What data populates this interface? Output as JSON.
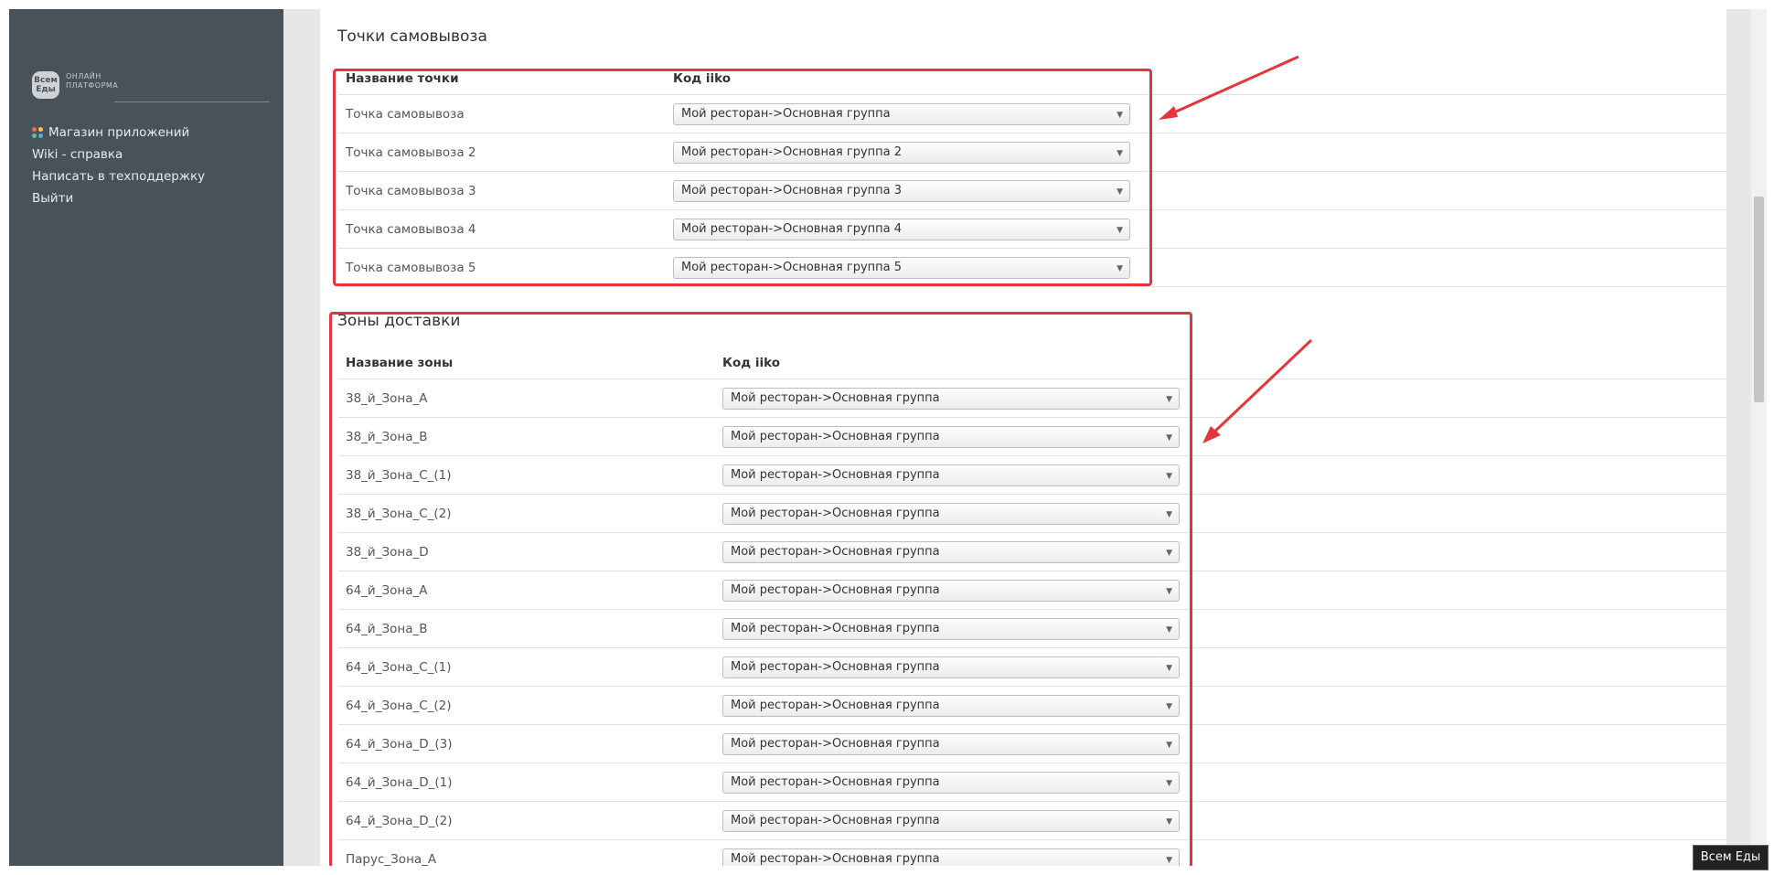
{
  "sidebar": {
    "logo_badge": "Всем Еды",
    "logo_text": "ОНЛАЙН ПЛАТФОРМА",
    "items": [
      {
        "label": "Магазин приложений"
      },
      {
        "label": "Wiki - справка"
      },
      {
        "label": "Написать в техподдержку"
      },
      {
        "label": "Выйти"
      }
    ]
  },
  "pickup": {
    "title": "Точки самовывоза",
    "col_name": "Название точки",
    "col_code": "Код iiko",
    "rows": [
      {
        "name": "Точка самовывоза",
        "value": "Мой ресторан->Основная группа"
      },
      {
        "name": "Точка самовывоза 2",
        "value": "Мой ресторан->Основная группа 2"
      },
      {
        "name": "Точка самовывоза 3",
        "value": "Мой ресторан->Основная группа 3"
      },
      {
        "name": "Точка самовывоза 4",
        "value": "Мой ресторан->Основная группа 4"
      },
      {
        "name": "Точка самовывоза 5",
        "value": "Мой ресторан->Основная группа 5"
      }
    ]
  },
  "zones": {
    "title": "Зоны доставки",
    "col_name": "Название зоны",
    "col_code": "Код iiko",
    "rows": [
      {
        "name": "38_й_Зона_A",
        "value": "Мой ресторан->Основная группа"
      },
      {
        "name": "38_й_Зона_B",
        "value": "Мой ресторан->Основная группа"
      },
      {
        "name": "38_й_Зона_C_(1)",
        "value": "Мой ресторан->Основная группа"
      },
      {
        "name": "38_й_Зона_C_(2)",
        "value": "Мой ресторан->Основная группа"
      },
      {
        "name": "38_й_Зона_D",
        "value": "Мой ресторан->Основная группа"
      },
      {
        "name": "64_й_Зона_A",
        "value": "Мой ресторан->Основная группа"
      },
      {
        "name": "64_й_Зона_B",
        "value": "Мой ресторан->Основная группа"
      },
      {
        "name": "64_й_Зона_C_(1)",
        "value": "Мой ресторан->Основная группа"
      },
      {
        "name": "64_й_Зона_C_(2)",
        "value": "Мой ресторан->Основная группа"
      },
      {
        "name": "64_й_Зона_D_(3)",
        "value": "Мой ресторан->Основная группа"
      },
      {
        "name": "64_й_Зона_D_(1)",
        "value": "Мой ресторан->Основная группа"
      },
      {
        "name": "64_й_Зона_D_(2)",
        "value": "Мой ресторан->Основная группа"
      },
      {
        "name": "Парус_Зона_A",
        "value": "Мой ресторан->Основная группа"
      }
    ]
  },
  "tooltip": "Всем Еды",
  "colors": {
    "sidebar": "#47525a",
    "annotation": "#e4353a"
  }
}
